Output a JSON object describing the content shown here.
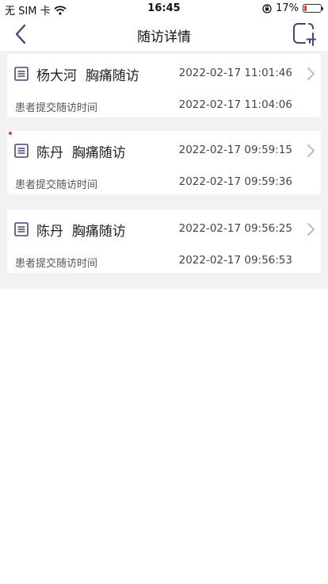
{
  "status_bar": {
    "carrier": "无 SIM 卡",
    "time": "16:45",
    "battery": "17%",
    "battery_level": 0.17
  },
  "nav": {
    "title": "随访详情"
  },
  "records": [
    {
      "patient": "杨大河",
      "type": "胸痛随访",
      "created_time": "2022-02-17 11:01:46",
      "submit_label": "患者提交随访时间",
      "submit_time": "2022-02-17 11:04:06"
    },
    {
      "patient": "陈丹",
      "type": "胸痛随访",
      "created_time": "2022-02-17 09:59:15",
      "submit_label": "患者提交随访时间",
      "submit_time": "2022-02-17 09:59:36"
    },
    {
      "patient": "陈丹",
      "type": "胸痛随访",
      "created_time": "2022-02-17 09:56:25",
      "submit_label": "患者提交随访时间",
      "submit_time": "2022-02-17 09:56:53"
    }
  ],
  "colors": {
    "accent": "#4a4470",
    "background": "#f2f2f4",
    "battery_low": "#e53935"
  }
}
